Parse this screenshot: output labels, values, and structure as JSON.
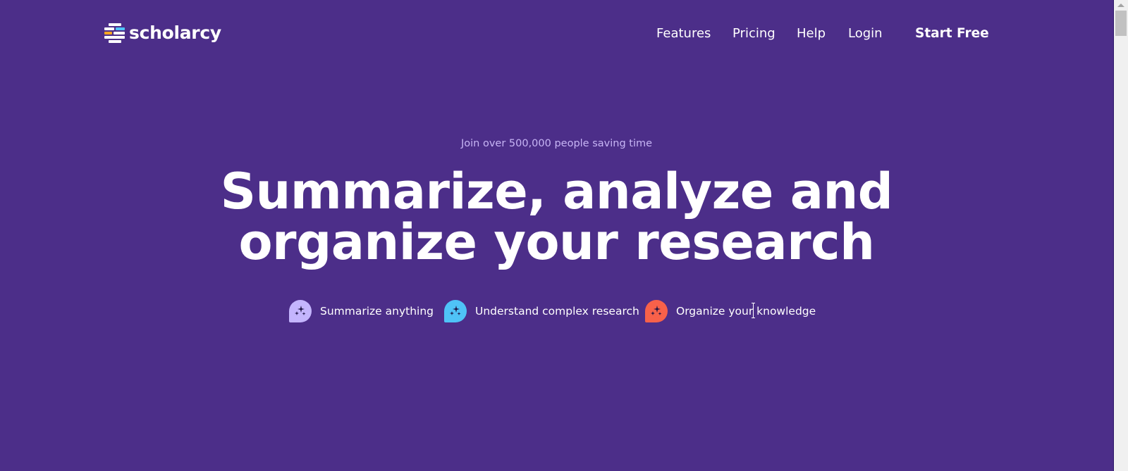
{
  "brand": {
    "name": "scholarcy",
    "colors": {
      "background": "#4c2e89",
      "tagline": "#c7b5f5",
      "logo_blue": "#4fc3f7",
      "logo_orange": "#f5a623"
    }
  },
  "nav": {
    "items": [
      {
        "label": "Features"
      },
      {
        "label": "Pricing"
      },
      {
        "label": "Help"
      },
      {
        "label": "Login"
      }
    ],
    "cta_label": "Start Free"
  },
  "hero": {
    "tagline": "Join over 500,000 people saving time",
    "headline_line1": "Summarize, analyze and",
    "headline_line2": "organize your research",
    "features": [
      {
        "label": "Summarize anything",
        "icon": "sparkles-icon",
        "color": "#c4b5fd"
      },
      {
        "label": "Understand complex research",
        "icon": "sparkles-icon",
        "color": "#4fc3f7"
      },
      {
        "label": "Organize your knowledge",
        "icon": "sparkles-icon",
        "color": "#f8614a"
      }
    ]
  }
}
